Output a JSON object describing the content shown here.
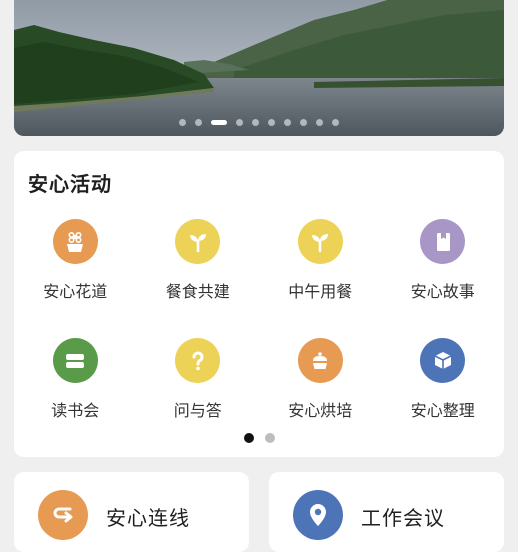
{
  "banner": {
    "page_count": 10,
    "active_index": 2
  },
  "activities": {
    "title": "安心活动",
    "items": [
      {
        "label": "安心花道",
        "icon": "flower-pot-icon",
        "color": "#e69a52"
      },
      {
        "label": "餐食共建",
        "icon": "sprout-icon",
        "color": "#ecd257"
      },
      {
        "label": "中午用餐",
        "icon": "sprout-icon",
        "color": "#ecd257"
      },
      {
        "label": "安心故事",
        "icon": "book-icon",
        "color": "#a896c7"
      },
      {
        "label": "读书会",
        "icon": "stack-icon",
        "color": "#5a9b4a"
      },
      {
        "label": "问与答",
        "icon": "question-icon",
        "color": "#ecd257"
      },
      {
        "label": "安心烘培",
        "icon": "cake-icon",
        "color": "#e69a52"
      },
      {
        "label": "安心整理",
        "icon": "box-icon",
        "color": "#4e74b8"
      }
    ],
    "page_count": 2,
    "active_page": 0
  },
  "shortcuts": [
    {
      "label": "安心连线",
      "icon": "return-arrow-icon",
      "color": "#e69a52"
    },
    {
      "label": "工作会议",
      "icon": "location-pin-icon",
      "color": "#4e74b8"
    }
  ]
}
